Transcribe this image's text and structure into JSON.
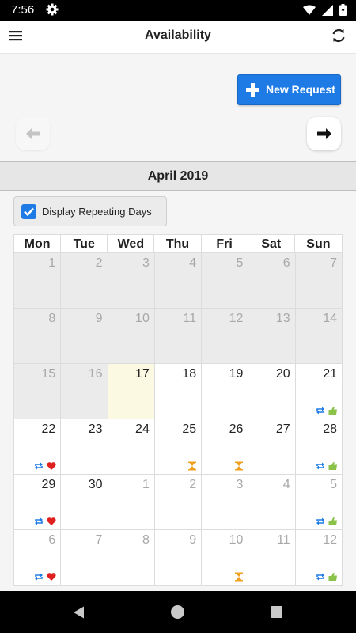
{
  "status_bar": {
    "time": "7:56",
    "icons": [
      "gear-icon",
      "wifi-icon",
      "signal-icon",
      "battery-icon"
    ]
  },
  "header": {
    "title": "Availability",
    "menu_icon": "menu-icon",
    "refresh_icon": "refresh-icon"
  },
  "actions": {
    "new_request_label": "New Request",
    "prev_icon": "arrow-left-icon",
    "next_icon": "arrow-right-icon"
  },
  "calendar": {
    "month_label": "April 2019",
    "repeat_label": "Display Repeating Days",
    "repeat_checked": true,
    "weekdays": [
      "Mon",
      "Tue",
      "Wed",
      "Thu",
      "Fri",
      "Sat",
      "Sun"
    ],
    "weeks": [
      [
        {
          "day": "1",
          "state": "past"
        },
        {
          "day": "2",
          "state": "past"
        },
        {
          "day": "3",
          "state": "past"
        },
        {
          "day": "4",
          "state": "past"
        },
        {
          "day": "5",
          "state": "past"
        },
        {
          "day": "6",
          "state": "past"
        },
        {
          "day": "7",
          "state": "past"
        }
      ],
      [
        {
          "day": "8",
          "state": "past"
        },
        {
          "day": "9",
          "state": "past"
        },
        {
          "day": "10",
          "state": "past"
        },
        {
          "day": "11",
          "state": "past"
        },
        {
          "day": "12",
          "state": "past"
        },
        {
          "day": "13",
          "state": "past"
        },
        {
          "day": "14",
          "state": "past"
        }
      ],
      [
        {
          "day": "15",
          "state": "past"
        },
        {
          "day": "16",
          "state": "past"
        },
        {
          "day": "17",
          "state": "today"
        },
        {
          "day": "18",
          "state": "current"
        },
        {
          "day": "19",
          "state": "current"
        },
        {
          "day": "20",
          "state": "current"
        },
        {
          "day": "21",
          "state": "current",
          "icons": [
            "repeat-icon",
            "thumbs-up-icon"
          ]
        }
      ],
      [
        {
          "day": "22",
          "state": "current",
          "icons": [
            "repeat-icon",
            "heart-icon"
          ]
        },
        {
          "day": "23",
          "state": "current"
        },
        {
          "day": "24",
          "state": "current"
        },
        {
          "day": "25",
          "state": "current",
          "icons": [
            "hourglass-icon"
          ]
        },
        {
          "day": "26",
          "state": "current",
          "icons": [
            "hourglass-icon"
          ]
        },
        {
          "day": "27",
          "state": "current"
        },
        {
          "day": "28",
          "state": "current",
          "icons": [
            "repeat-icon",
            "thumbs-up-icon"
          ]
        }
      ],
      [
        {
          "day": "29",
          "state": "current",
          "icons": [
            "repeat-icon",
            "heart-icon"
          ]
        },
        {
          "day": "30",
          "state": "current"
        },
        {
          "day": "1",
          "state": "other"
        },
        {
          "day": "2",
          "state": "other"
        },
        {
          "day": "3",
          "state": "other"
        },
        {
          "day": "4",
          "state": "other"
        },
        {
          "day": "5",
          "state": "other",
          "icons": [
            "repeat-icon",
            "thumbs-up-icon"
          ]
        }
      ],
      [
        {
          "day": "6",
          "state": "other",
          "icons": [
            "repeat-icon",
            "heart-icon"
          ]
        },
        {
          "day": "7",
          "state": "other"
        },
        {
          "day": "8",
          "state": "other"
        },
        {
          "day": "9",
          "state": "other"
        },
        {
          "day": "10",
          "state": "other",
          "icons": [
            "hourglass-icon"
          ]
        },
        {
          "day": "11",
          "state": "other"
        },
        {
          "day": "12",
          "state": "other",
          "icons": [
            "repeat-icon",
            "thumbs-up-icon"
          ]
        }
      ]
    ]
  },
  "colors": {
    "accent": "#1e7be6",
    "past_day": "#ebebeb",
    "today": "#fcf9e3",
    "heart": "#e01f1f",
    "thumb": "#8bc34a",
    "hourglass": "#f0a020",
    "repeat": "#1e7be6"
  },
  "system_nav": {
    "icons": [
      "back-icon",
      "home-icon",
      "recents-icon"
    ]
  }
}
